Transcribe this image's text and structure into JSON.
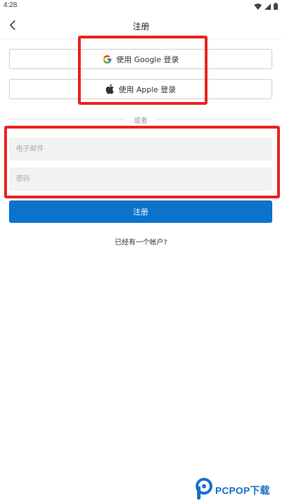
{
  "status_bar": {
    "time": "4:28",
    "icons": [
      "wifi-icon",
      "signal-icon",
      "battery-icon"
    ]
  },
  "header": {
    "title": "注册",
    "back_icon": "chevron-left-icon"
  },
  "social_login": {
    "google_label": "使用 Google 登录",
    "apple_label": "使用 Apple 登录"
  },
  "divider": {
    "text": "或者"
  },
  "form": {
    "email_placeholder": "电子邮件",
    "password_placeholder": "密码",
    "submit_label": "注册",
    "submit_color": "#0a73cc"
  },
  "footer": {
    "login_prompt": "已经有一个帐户?"
  },
  "annotations": {
    "highlight_color": "#e8231f"
  },
  "watermark": {
    "text": "PCPOP下载",
    "brand_color": "#1a6fc9"
  }
}
